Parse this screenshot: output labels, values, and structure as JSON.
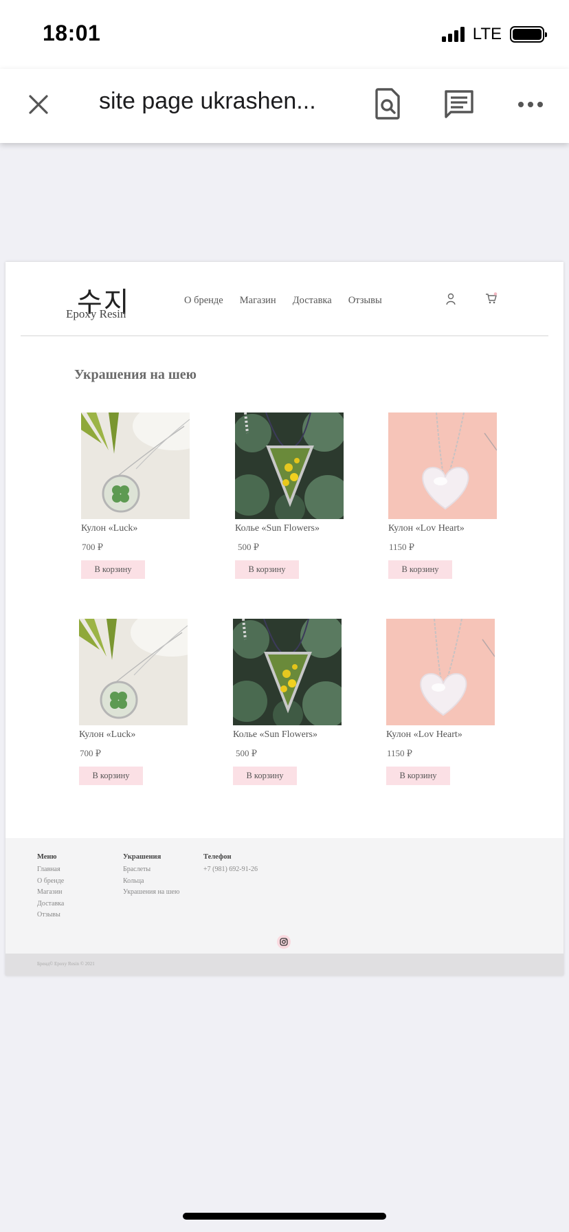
{
  "status_bar": {
    "time": "18:01",
    "network": "LTE",
    "icons": [
      "signal-icon",
      "battery-icon"
    ]
  },
  "toolbar": {
    "title": "site page ukrashen...",
    "icons": [
      "close-icon",
      "find-in-page-icon",
      "comment-icon",
      "more-icon"
    ]
  },
  "site": {
    "logo": {
      "hangul": "수지",
      "subtitle": "Epoxy Resin"
    },
    "nav": [
      "О бренде",
      "Магазин",
      "Доставка",
      "Отзывы"
    ],
    "header_icons": [
      "user-icon",
      "cart-icon"
    ],
    "section_title": "Украшения на шею",
    "products": [
      {
        "name": "Кулон «Luck»",
        "price": "700 ₽",
        "button": "В корзину",
        "image": "clover-pendant-image"
      },
      {
        "name": "Колье «Sun Flowers»",
        "price": "500 ₽",
        "button": "В корзину",
        "image": "triangle-flower-necklace-image"
      },
      {
        "name": "Кулон «Lov Heart»",
        "price": "1150 ₽",
        "button": "В корзину",
        "image": "heart-pendant-image"
      },
      {
        "name": "Кулон «Luck»",
        "price": "700 ₽",
        "button": "В корзину",
        "image": "clover-pendant-image"
      },
      {
        "name": "Колье «Sun Flowers»",
        "price": "500 ₽",
        "button": "В корзину",
        "image": "triangle-flower-necklace-image"
      },
      {
        "name": "Кулон «Lov Heart»",
        "price": "1150 ₽",
        "button": "В корзину",
        "image": "heart-pendant-image"
      }
    ],
    "footer": {
      "menu": {
        "heading": "Меню",
        "items": [
          "Главная",
          "О бренде",
          "Магазин",
          "Доставка",
          "Отзывы"
        ]
      },
      "jewelry": {
        "heading": "Украшения",
        "items": [
          "Браслеты",
          "Кольца",
          "Украшения на шею"
        ]
      },
      "phone": {
        "heading": "Телефон",
        "value": "+7 (981) 692-91-26"
      },
      "social_icon": "instagram-icon",
      "copyright": "Бренд© Epoxy Resin © 2021"
    }
  },
  "colors": {
    "button_bg": "#fbe0e5",
    "page_bg": "#f0f0f5",
    "footer_bg": "#f4f4f5"
  }
}
